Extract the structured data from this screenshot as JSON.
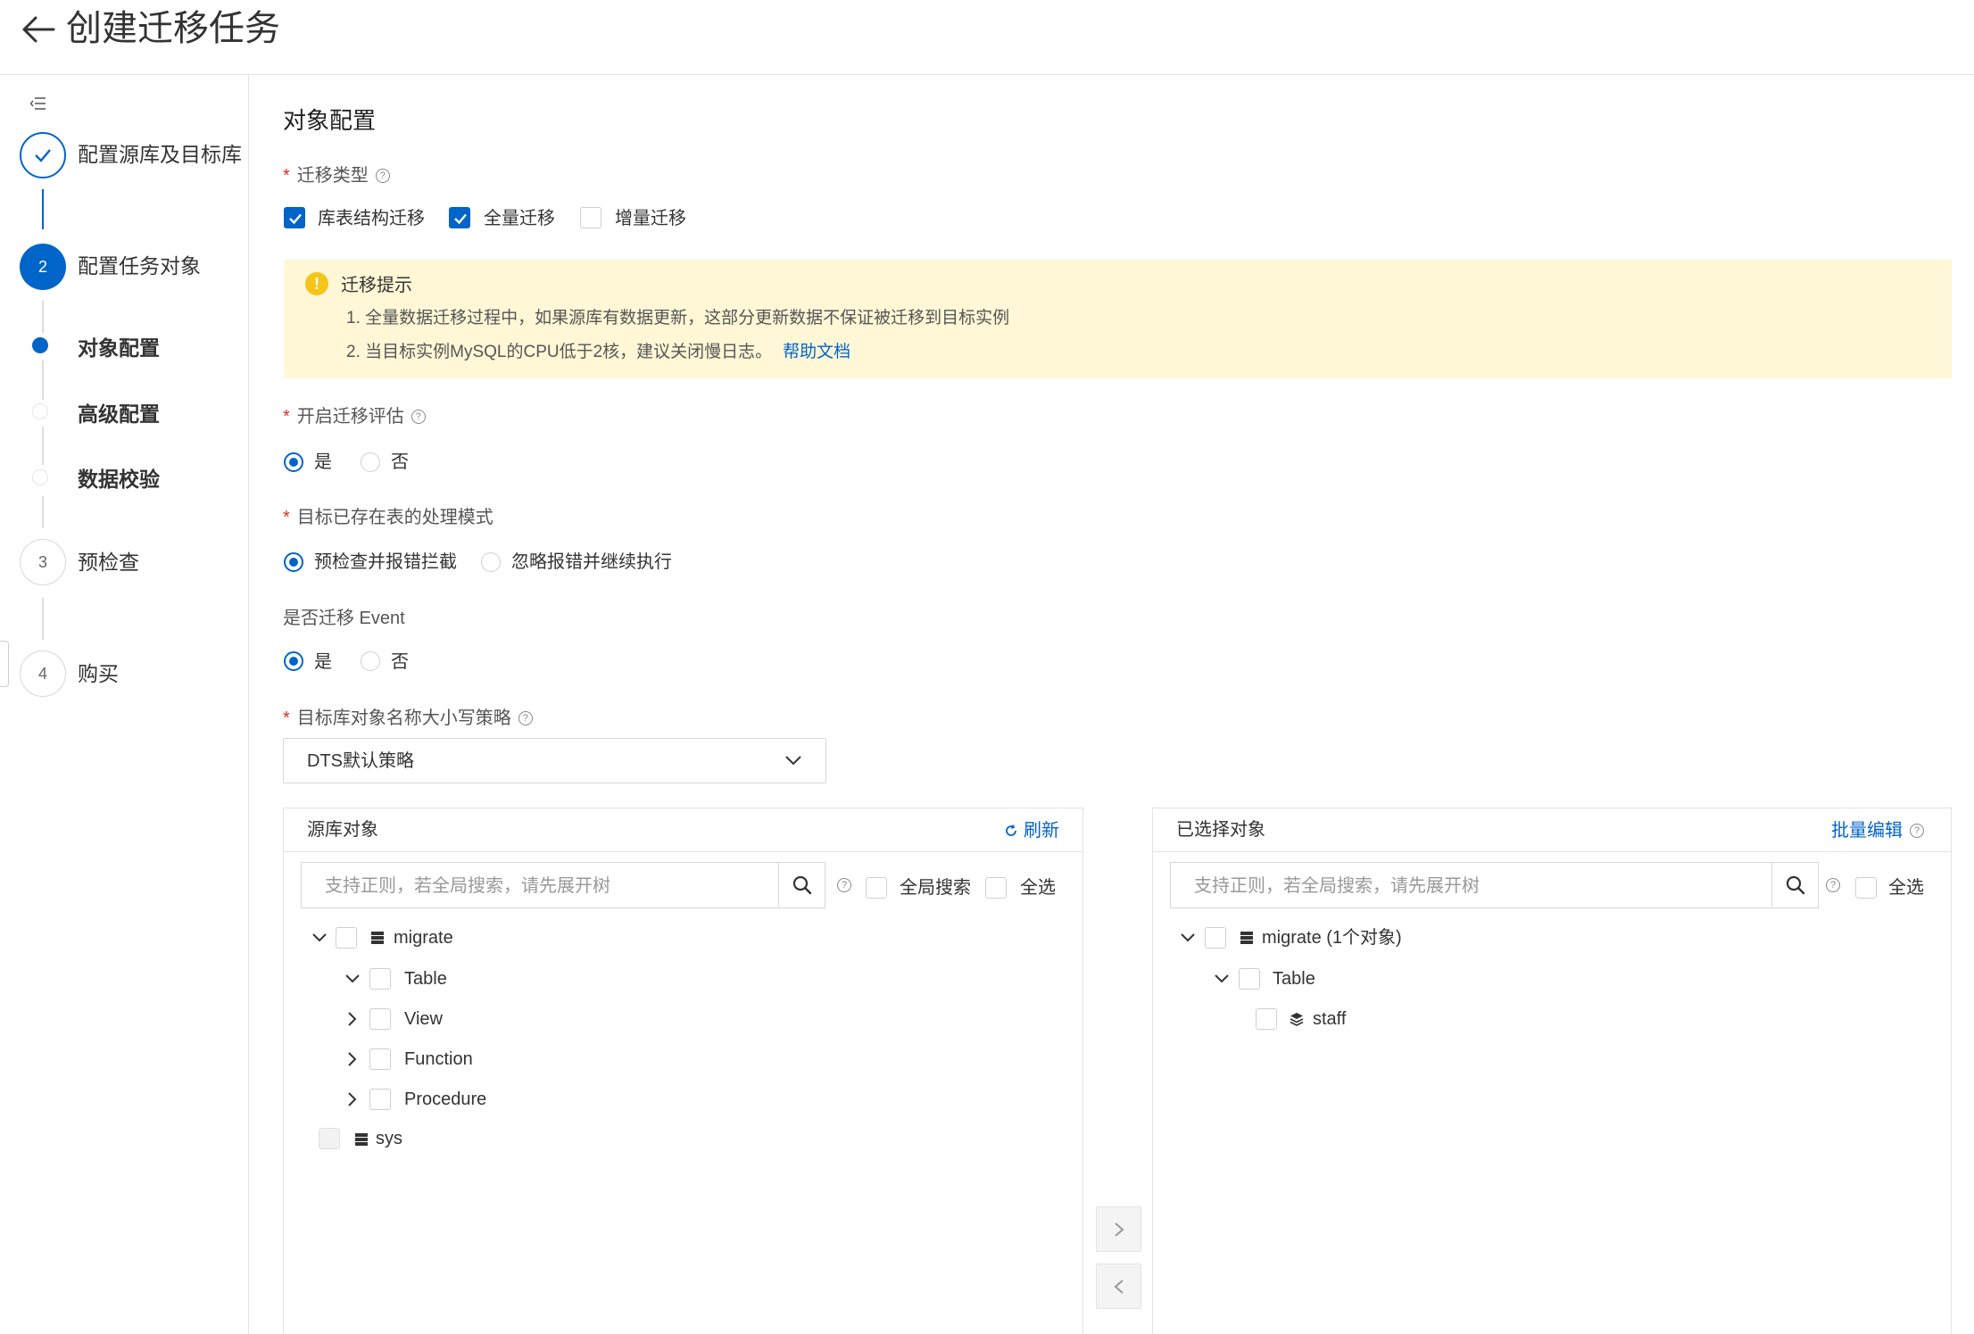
{
  "header": {
    "title": "创建迁移任务"
  },
  "sidebar": {
    "steps": [
      {
        "number": "",
        "label": "配置源库及目标库"
      },
      {
        "number": "2",
        "label": "配置任务对象"
      },
      {
        "number": "3",
        "label": "预检查"
      },
      {
        "number": "4",
        "label": "购买"
      }
    ],
    "substeps": [
      {
        "label": "对象配置"
      },
      {
        "label": "高级配置"
      },
      {
        "label": "数据校验"
      }
    ]
  },
  "main": {
    "section_title": "对象配置",
    "migration_type": {
      "label": "迁移类型",
      "options": [
        {
          "label": "库表结构迁移",
          "checked": true
        },
        {
          "label": "全量迁移",
          "checked": true
        },
        {
          "label": "增量迁移",
          "checked": false
        }
      ]
    },
    "notice": {
      "title": "迁移提示",
      "lines": [
        "1. 全量数据迁移过程中，如果源库有数据更新，这部分更新数据不保证被迁移到目标实例",
        "2. 当目标实例MySQL的CPU低于2核，建议关闭慢日志。"
      ],
      "link": "帮助文档"
    },
    "assessment": {
      "label": "开启迁移评估",
      "options": [
        "是",
        "否"
      ],
      "selected": "是"
    },
    "existing_table": {
      "label": "目标已存在表的处理模式",
      "options": [
        "预检查并报错拦截",
        "忽略报错并继续执行"
      ],
      "selected": "预检查并报错拦截"
    },
    "migrate_event": {
      "label": "是否迁移 Event",
      "options": [
        "是",
        "否"
      ],
      "selected": "是"
    },
    "case_policy": {
      "label": "目标库对象名称大小写策略",
      "value": "DTS默认策略"
    },
    "source_panel": {
      "title": "源库对象",
      "refresh": "刷新",
      "search_placeholder": "支持正则，若全局搜索，请先展开树",
      "global_search": "全局搜索",
      "select_all": "全选",
      "tree": {
        "db": "migrate",
        "children": [
          "Table",
          "View",
          "Function",
          "Procedure"
        ],
        "other_db": "sys"
      }
    },
    "selected_panel": {
      "title": "已选择对象",
      "batch_edit": "批量编辑",
      "search_placeholder": "支持正则，若全局搜索，请先展开树",
      "select_all": "全选",
      "tree": {
        "db": "migrate (1个对象)",
        "group": "Table",
        "item": "staff"
      }
    }
  },
  "colors": {
    "primary": "#0064c8",
    "notice_bg": "#fff7d6",
    "warning_icon": "#f5c518",
    "required": "#d93026"
  },
  "icons": [
    "back-arrow-icon",
    "collapse-menu-icon",
    "check-icon",
    "help-icon",
    "warning-icon",
    "chevron-down-icon",
    "refresh-icon",
    "search-icon",
    "database-icon",
    "layers-icon",
    "chevron-right-icon",
    "chevron-left-icon"
  ]
}
